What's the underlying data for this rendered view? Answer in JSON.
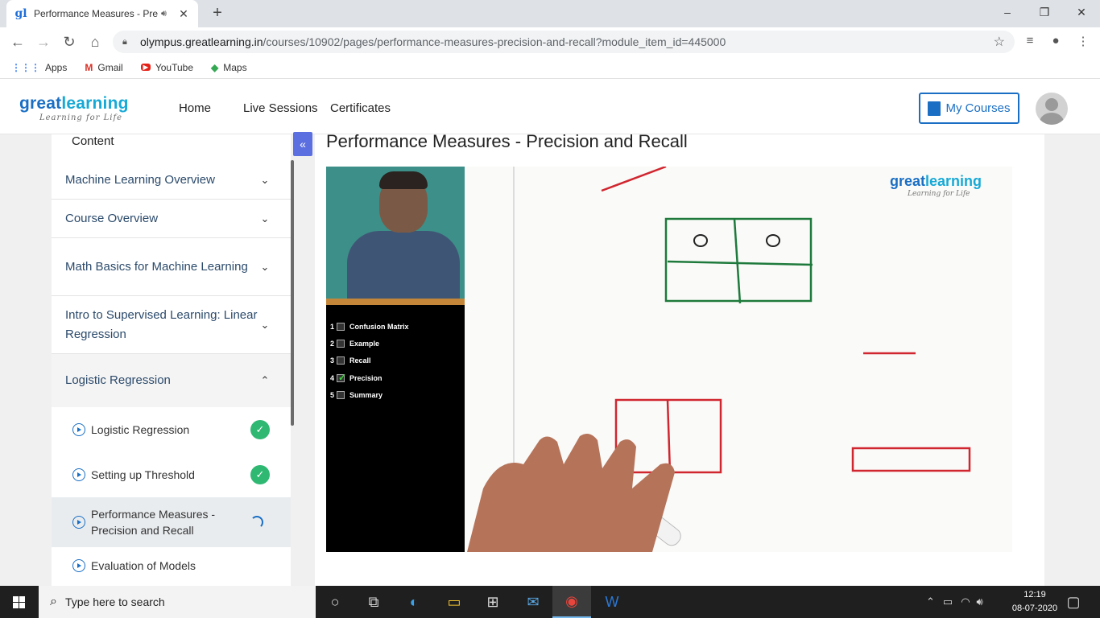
{
  "browser": {
    "tab_title": "Performance Measures - Pre",
    "url_host": "olympus.greatlearning.in",
    "url_path": "/courses/10902/pages/performance-measures-precision-and-recall?module_item_id=445000",
    "bookmarks": [
      "Apps",
      "Gmail",
      "YouTube",
      "Maps"
    ]
  },
  "header": {
    "logo_main": "great",
    "logo_accent": "learning",
    "logo_tagline": "Learning for Life",
    "nav": [
      "Home",
      "Live Sessions",
      "Certificates"
    ],
    "my_courses": "My Courses"
  },
  "sidebar": {
    "content_label": "Content",
    "modules": [
      {
        "label": "Machine Learning Overview",
        "expanded": false
      },
      {
        "label": "Course Overview",
        "expanded": false
      },
      {
        "label": "Math Basics for Machine Learning",
        "expanded": false
      },
      {
        "label": "Intro to Supervised Learning: Linear Regression",
        "expanded": false
      },
      {
        "label": "Logistic Regression",
        "expanded": true
      }
    ],
    "items": [
      {
        "label": "Logistic Regression",
        "status": "completed"
      },
      {
        "label": "Setting up Threshold",
        "status": "completed"
      },
      {
        "label": "Performance Measures - Precision and Recall",
        "status": "in-progress"
      },
      {
        "label": "Evaluation of Models",
        "status": "none"
      }
    ]
  },
  "main": {
    "page_title": "Performance Measures - Precision and Recall",
    "video": {
      "chapters": [
        {
          "num": "1",
          "label": "Confusion Matrix",
          "checked": false
        },
        {
          "num": "2",
          "label": "Example",
          "checked": false
        },
        {
          "num": "3",
          "label": "Recall",
          "checked": false
        },
        {
          "num": "4",
          "label": "Precision",
          "checked": true
        },
        {
          "num": "5",
          "label": "Summary",
          "checked": false
        }
      ],
      "watermark_main": "great",
      "watermark_accent": "learning",
      "watermark_tagline": "Learning for Life"
    }
  },
  "taskbar": {
    "search_placeholder": "Type here to search",
    "time": "12:19",
    "date": "08-07-2020"
  },
  "colors": {
    "brand_blue": "#1a6fc4",
    "success_green": "#2eb872",
    "collapse_button": "#5b6fe0"
  }
}
